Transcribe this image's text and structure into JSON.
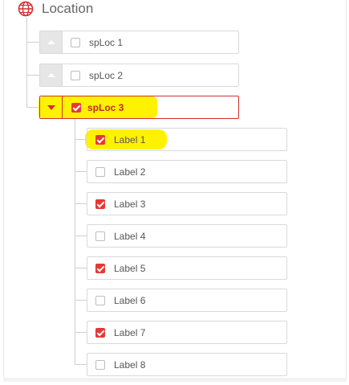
{
  "header": {
    "title": "Location",
    "icon": "globe-icon",
    "icon_color": "#d32f2f"
  },
  "tree": {
    "top_nodes": [
      {
        "label": "spLoc 1",
        "checked": false,
        "expanded": false
      },
      {
        "label": "spLoc 2",
        "checked": false,
        "expanded": false
      },
      {
        "label": "spLoc 3",
        "checked": true,
        "expanded": true
      }
    ],
    "children": [
      {
        "label": "Label 1",
        "checked": true
      },
      {
        "label": "Label 2",
        "checked": false
      },
      {
        "label": "Label 3",
        "checked": true
      },
      {
        "label": "Label 4",
        "checked": false
      },
      {
        "label": "Label 5",
        "checked": true
      },
      {
        "label": "Label 6",
        "checked": false
      },
      {
        "label": "Label 7",
        "checked": true
      },
      {
        "label": "Label 8",
        "checked": false
      }
    ]
  },
  "colors": {
    "accent": "#e53935",
    "highlight": "#fff200",
    "border": "#d9d9d9"
  }
}
